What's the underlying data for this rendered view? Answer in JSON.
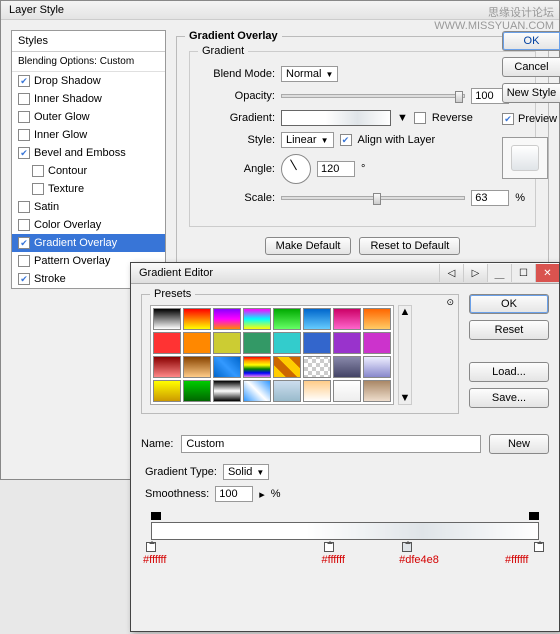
{
  "watermark": {
    "line1": "思缘设计论坛",
    "line2": "WWW.MISSYUAN.COM"
  },
  "layerStyle": {
    "title": "Layer Style",
    "stylesHeader": "Styles",
    "blendingOptions": "Blending Options: Custom",
    "items": [
      {
        "label": "Drop Shadow",
        "checked": true
      },
      {
        "label": "Inner Shadow",
        "checked": false
      },
      {
        "label": "Outer Glow",
        "checked": false
      },
      {
        "label": "Inner Glow",
        "checked": false
      },
      {
        "label": "Bevel and Emboss",
        "checked": true
      },
      {
        "label": "Satin",
        "checked": false
      },
      {
        "label": "Color Overlay",
        "checked": false
      },
      {
        "label": "Gradient Overlay",
        "checked": true,
        "selected": true
      },
      {
        "label": "Pattern Overlay",
        "checked": false
      },
      {
        "label": "Stroke",
        "checked": true
      }
    ],
    "bevelSub": [
      {
        "label": "Contour",
        "checked": false
      },
      {
        "label": "Texture",
        "checked": false
      }
    ],
    "sideButtons": {
      "ok": "OK",
      "cancel": "Cancel",
      "newStyle": "New Style",
      "preview": "Preview"
    },
    "panel": {
      "legend": "Gradient Overlay",
      "innerLegend": "Gradient",
      "blendModeLabel": "Blend Mode:",
      "blendMode": "Normal",
      "opacityLabel": "Opacity:",
      "opacity": "100",
      "opacityUnit": "%",
      "gradientLabel": "Gradient:",
      "reverse": "Reverse",
      "styleLabel": "Style:",
      "style": "Linear",
      "alignWithLayer": "Align with Layer",
      "angleLabel": "Angle:",
      "angle": "120",
      "angleUnit": "°",
      "scaleLabel": "Scale:",
      "scale": "63",
      "scaleUnit": "%",
      "makeDefault": "Make Default",
      "resetDefault": "Reset to Default"
    }
  },
  "gradientEditor": {
    "title": "Gradient Editor",
    "presetsLabel": "Presets",
    "nameLabel": "Name:",
    "nameValue": "Custom",
    "buttons": {
      "ok": "OK",
      "cancel": "Reset",
      "load": "Load...",
      "save": "Save...",
      "new": "New"
    },
    "gradientTypeLabel": "Gradient Type:",
    "gradientType": "Solid",
    "smoothnessLabel": "Smoothness:",
    "smoothness": "100",
    "smoothnessUnit": "%",
    "colorStops": [
      {
        "color": "#ffffff",
        "position": 0
      },
      {
        "color": "#ffffff",
        "position": 46
      },
      {
        "color": "#dfe4e8",
        "position": 66
      },
      {
        "color": "#ffffff",
        "position": 100
      }
    ],
    "swatches": [
      "linear-gradient(#000,#fff)",
      "linear-gradient(#f00,#ff0)",
      "linear-gradient(#80f,#f0f,#f80)",
      "linear-gradient(#f0f,#0ff,#ff0)",
      "linear-gradient(#0a0,#6f6)",
      "linear-gradient(#06c,#6cf)",
      "linear-gradient(#c06,#f6c)",
      "linear-gradient(#f60,#fc6)",
      "#f33",
      "#f80",
      "#cc3",
      "#396",
      "#3cc",
      "#36c",
      "#93c",
      "#c3c",
      "linear-gradient(#800,#f88)",
      "linear-gradient(#840,#fc8)",
      "linear-gradient(45deg,#06c,#39f,#06c)",
      "linear-gradient(red,orange,yellow,green,blue,violet)",
      "linear-gradient(45deg,#fc0 25%,#c60 25%,#c60 50%,#fc0 50%,#fc0 75%,#c60 75%)",
      "repeating-conic-gradient(#ccc 0 25%,#fff 0 50%) 0/8px 8px",
      "linear-gradient(#88a,#446)",
      "linear-gradient(#eef,#88c)",
      "linear-gradient(#ff0,#c90)",
      "linear-gradient(#0c0,#060)",
      "linear-gradient(#000,#fff,#000)",
      "linear-gradient(45deg,#39f,#fff,#39f)",
      "linear-gradient(#cde,#9bc)",
      "linear-gradient(#fc8,#fff)",
      "linear-gradient(#fff,#eee)",
      "linear-gradient(#a86,#edc)"
    ]
  }
}
